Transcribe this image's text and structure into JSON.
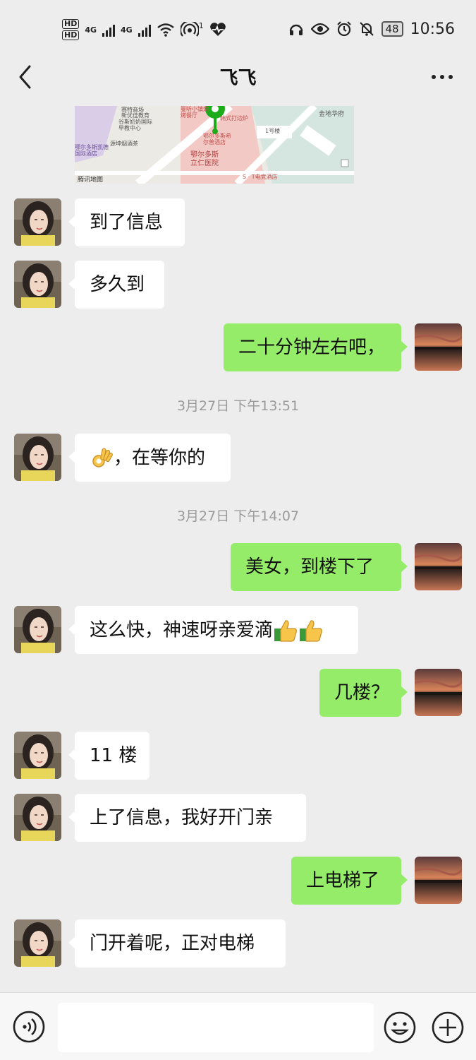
{
  "status_bar": {
    "hd1": "HD",
    "hd2": "HD",
    "net1": "4G",
    "net2": "4G",
    "hotspot_count": "1",
    "battery": "48",
    "time": "10:56"
  },
  "header": {
    "title": "飞飞"
  },
  "map": {
    "labels": [
      "赛特商场",
      "新优佳教育",
      "谷斯奶奶国际早教中心",
      "鄂尔多斯凯德国际酒店",
      "源坤烟酒茶",
      "曼听小镇烧烤餐厅",
      "韩式打边炉",
      "鄂尔多斯希尔普酒店",
      "鄂尔多斯立仁医院",
      "金地华府",
      "1号楼",
      "S · T电竞酒店",
      "腾讯地图"
    ]
  },
  "messages": [
    {
      "from": "them",
      "text": "到了信息"
    },
    {
      "from": "them",
      "text": "多久到"
    },
    {
      "from": "me",
      "text": "二十分钟左右吧，"
    },
    {
      "type": "time",
      "text": "3月27日 下午13:51"
    },
    {
      "from": "them",
      "text": "，在等你的",
      "emoji_before": "ok-hand"
    },
    {
      "type": "time",
      "text": "3月27日 下午14:07"
    },
    {
      "from": "me",
      "text": "美女，到楼下了"
    },
    {
      "from": "them",
      "text": "这么快，神速呀亲爱滴",
      "emoji_after": [
        "thumbs-up",
        "thumbs-up"
      ]
    },
    {
      "from": "me",
      "text": "几楼？"
    },
    {
      "from": "them",
      "text": "11 楼"
    },
    {
      "from": "them",
      "text": "上了信息，我好开门亲"
    },
    {
      "from": "me",
      "text": "上电梯了"
    },
    {
      "from": "them",
      "text": "门开着呢，正对电梯"
    }
  ],
  "colors": {
    "bg": "#ededed",
    "outgoing": "#95ec69",
    "incoming": "#ffffff",
    "timestamp": "#9a9a9a"
  },
  "icons": [
    "back-arrow-icon",
    "more-icon",
    "voice-icon",
    "emoji-icon",
    "plus-icon"
  ]
}
